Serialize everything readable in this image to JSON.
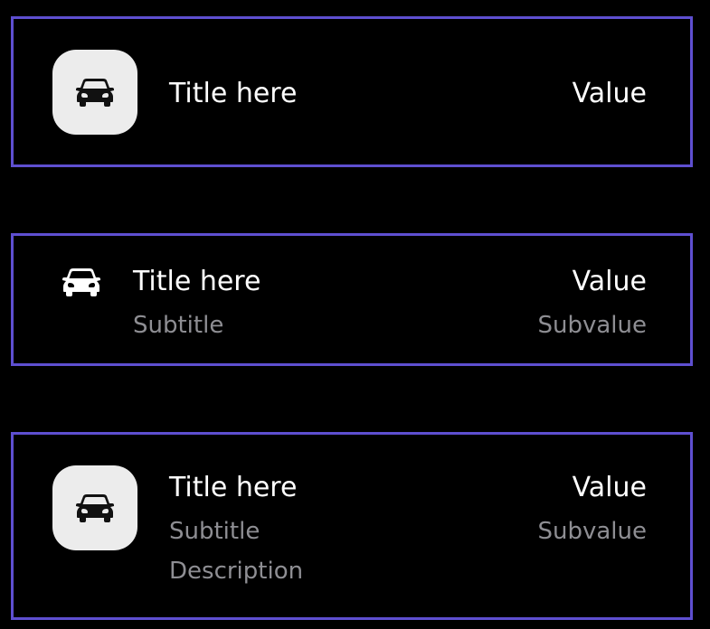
{
  "colors": {
    "background": "#000000",
    "row_border": "#5E4FD0",
    "icon_tile": "#ECECEC",
    "primary_text": "#FFFFFF",
    "secondary_text": "#8E8E93"
  },
  "rows": [
    {
      "icon": "car-icon",
      "icon_style": "tile",
      "title": "Title here",
      "value": "Value"
    },
    {
      "icon": "car-icon",
      "icon_style": "plain",
      "title": "Title here",
      "subtitle": "Subtitle",
      "value": "Value",
      "subvalue": "Subvalue"
    },
    {
      "icon": "car-icon",
      "icon_style": "tile",
      "title": "Title here",
      "subtitle": "Subtitle",
      "description": "Description",
      "value": "Value",
      "subvalue": "Subvalue"
    }
  ]
}
